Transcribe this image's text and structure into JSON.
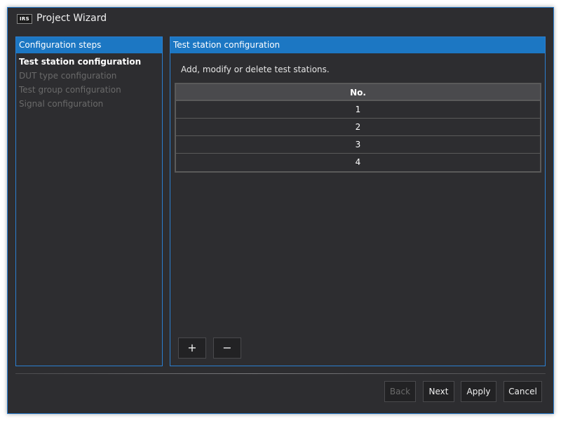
{
  "window": {
    "logo_text": "IRS",
    "title": "Project Wizard"
  },
  "steps_panel": {
    "header": "Configuration steps",
    "items": [
      {
        "label": "Test station configuration",
        "state": "active"
      },
      {
        "label": "DUT type configuration",
        "state": "disabled"
      },
      {
        "label": "Test group configuration",
        "state": "disabled"
      },
      {
        "label": "Signal configuration",
        "state": "disabled"
      }
    ]
  },
  "config_panel": {
    "header": "Test station configuration",
    "description": "Add, modify or delete test stations.",
    "table": {
      "columns": [
        "No."
      ],
      "rows": [
        "1",
        "2",
        "3",
        "4"
      ]
    },
    "add_label": "+",
    "remove_label": "−"
  },
  "footer": {
    "back_label": "Back",
    "next_label": "Next",
    "apply_label": "Apply",
    "cancel_label": "Cancel"
  },
  "colors": {
    "accent": "#1c77c3",
    "border": "#2b7fd1",
    "background": "#2d2d30"
  }
}
